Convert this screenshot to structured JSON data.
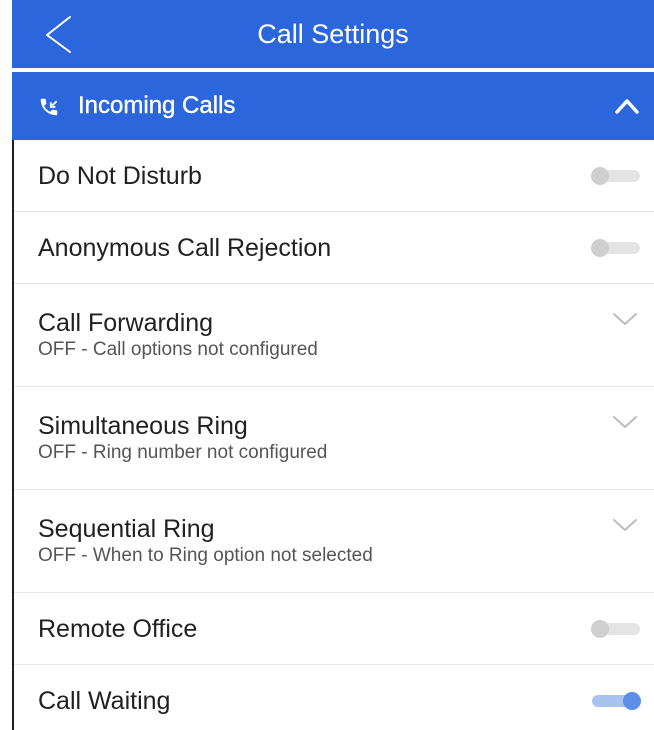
{
  "header": {
    "title": "Call Settings",
    "back_icon": "chevron-left-icon"
  },
  "section": {
    "title": "Incoming Calls",
    "icon": "phone-incoming-icon",
    "toggle_icon": "chevron-up-icon",
    "expanded": true
  },
  "items": [
    {
      "title": "Do Not Disturb",
      "control": "toggle",
      "on": false
    },
    {
      "title": "Anonymous Call Rejection",
      "control": "toggle",
      "on": false
    },
    {
      "title": "Call Forwarding",
      "subtitle": "OFF - Call options not configured",
      "control": "expand",
      "icon": "chevron-down-icon"
    },
    {
      "title": "Simultaneous Ring",
      "subtitle": "OFF - Ring number not configured",
      "control": "expand",
      "icon": "chevron-down-icon"
    },
    {
      "title": "Sequential Ring",
      "subtitle": "OFF - When to Ring option not selected",
      "control": "expand",
      "icon": "chevron-down-icon"
    },
    {
      "title": "Remote Office",
      "control": "toggle",
      "on": false
    },
    {
      "title": "Call Waiting",
      "control": "toggle",
      "on": true
    }
  ],
  "colors": {
    "primary": "#2c66dc",
    "title_text": "#212121",
    "subtitle_text": "#555555",
    "divider": "#e6e6e6",
    "chevron": "#bdbdbd",
    "toggle_on_thumb": "#5d8fe8",
    "toggle_on_track": "#a8c3f0",
    "toggle_off_thumb": "#cfcfcf",
    "toggle_off_track": "#e4e4e4",
    "frame": "#1f1f1f"
  }
}
